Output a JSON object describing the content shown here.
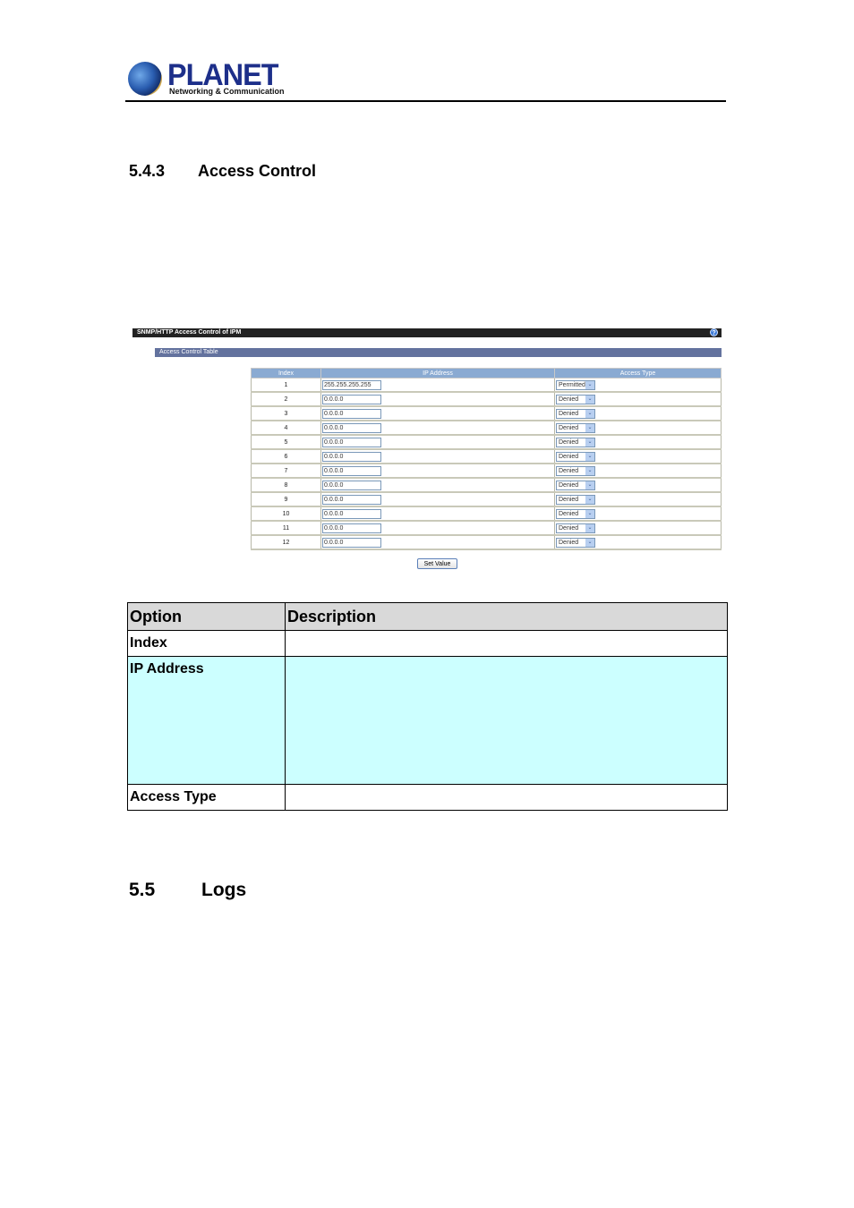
{
  "header": {
    "logo_word": "PLANET",
    "logo_tagline": "Networking & Communication"
  },
  "section_543": {
    "number": "5.4.3",
    "title": "Access Control"
  },
  "screenshot": {
    "title_bar": "SNMP/HTTP Access Control of IPM",
    "help_icon": "?",
    "sub_bar": "Access Control Table",
    "columns": [
      "Index",
      "IP Address",
      "Access Type"
    ],
    "rows": [
      {
        "index": "1",
        "ip": "255.255.255.255",
        "access": "Permitted"
      },
      {
        "index": "2",
        "ip": "0.0.0.0",
        "access": "Denied"
      },
      {
        "index": "3",
        "ip": "0.0.0.0",
        "access": "Denied"
      },
      {
        "index": "4",
        "ip": "0.0.0.0",
        "access": "Denied"
      },
      {
        "index": "5",
        "ip": "0.0.0.0",
        "access": "Denied"
      },
      {
        "index": "6",
        "ip": "0.0.0.0",
        "access": "Denied"
      },
      {
        "index": "7",
        "ip": "0.0.0.0",
        "access": "Denied"
      },
      {
        "index": "8",
        "ip": "0.0.0.0",
        "access": "Denied"
      },
      {
        "index": "9",
        "ip": "0.0.0.0",
        "access": "Denied"
      },
      {
        "index": "10",
        "ip": "0.0.0.0",
        "access": "Denied"
      },
      {
        "index": "11",
        "ip": "0.0.0.0",
        "access": "Denied"
      },
      {
        "index": "12",
        "ip": "0.0.0.0",
        "access": "Denied"
      }
    ],
    "dropdown_arrow": "⌄",
    "set_button": "Set Value"
  },
  "options_table": {
    "headers": [
      "Option",
      "Description"
    ],
    "rows": [
      {
        "option": "Index",
        "description": ""
      },
      {
        "option": "IP Address",
        "description": ""
      },
      {
        "option": "Access Type",
        "description": ""
      }
    ]
  },
  "section_55": {
    "number": "5.5",
    "title": "Logs"
  }
}
